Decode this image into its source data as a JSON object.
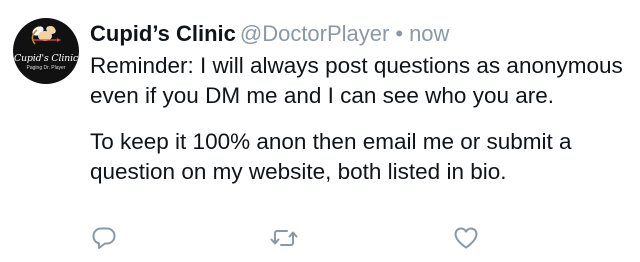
{
  "tweet": {
    "author": {
      "display_name": "Cupid’s Clinic",
      "handle": "@DoctorPlayer",
      "avatar_title": "Cupid's Clinic",
      "avatar_subtitle": "Paging Dr. Player"
    },
    "separator": "•",
    "timestamp": "now",
    "paragraphs": [
      "Reminder: I will always post questions as anonymous even if you DM me and I can see who you are.",
      "To keep it 100% anon then email me or submit a question on my website, both listed in bio."
    ]
  },
  "actions": {
    "reply": {
      "icon": "reply-icon"
    },
    "retweet": {
      "icon": "retweet-icon"
    },
    "like": {
      "icon": "heart-icon"
    }
  },
  "colors": {
    "text": "#0f1419",
    "muted": "#8b98a5",
    "icon": "#8b98a5",
    "avatar_bg": "#111111",
    "cupid_skin": "#f2d2a0",
    "cupid_wing": "#f6f6f6",
    "cupid_arrow": "#e24a4a"
  }
}
